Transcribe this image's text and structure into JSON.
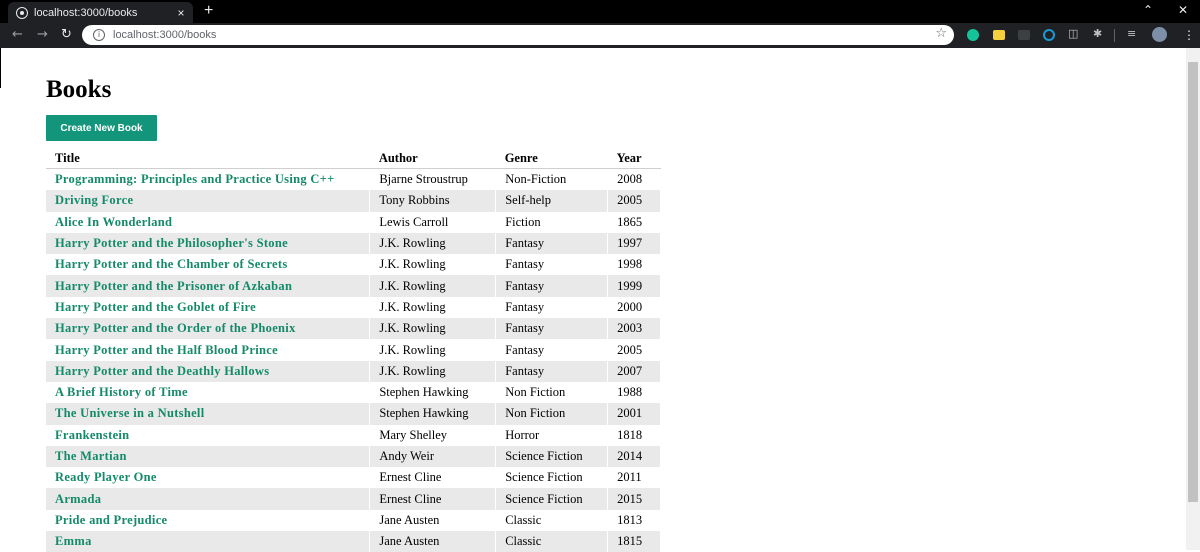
{
  "browser": {
    "tab_title": "localhost:3000/books",
    "tab_close": "×",
    "new_tab": "+",
    "url": "localhost:3000/books",
    "back": "←",
    "forward": "→",
    "reload": "↻",
    "star": "☆",
    "window_min": "⌃",
    "window_close": "✕",
    "menu": "⋮",
    "extensions": [
      "grammarly-icon",
      "notes-icon",
      "tab-icon",
      "record-icon",
      "translate-icon",
      "bug-icon",
      "playlist-icon",
      "profile-avatar"
    ]
  },
  "page": {
    "title": "Books",
    "create_button": "Create New Book"
  },
  "table": {
    "headers": [
      "Title",
      "Author",
      "Genre",
      "Year"
    ],
    "rows": [
      [
        "Programming: Principles and Practice Using C++",
        "Bjarne Stroustrup",
        "Non-Fiction",
        "2008"
      ],
      [
        "Driving Force",
        "Tony Robbins",
        "Self-help",
        "2005"
      ],
      [
        "Alice In Wonderland",
        "Lewis Carroll",
        "Fiction",
        "1865"
      ],
      [
        "Harry Potter and the Philosopher's Stone",
        "J.K. Rowling",
        "Fantasy",
        "1997"
      ],
      [
        "Harry Potter and the Chamber of Secrets",
        "J.K. Rowling",
        "Fantasy",
        "1998"
      ],
      [
        "Harry Potter and the Prisoner of Azkaban",
        "J.K. Rowling",
        "Fantasy",
        "1999"
      ],
      [
        "Harry Potter and the Goblet of Fire",
        "J.K. Rowling",
        "Fantasy",
        "2000"
      ],
      [
        "Harry Potter and the Order of the Phoenix",
        "J.K. Rowling",
        "Fantasy",
        "2003"
      ],
      [
        "Harry Potter and the Half Blood Prince",
        "J.K. Rowling",
        "Fantasy",
        "2005"
      ],
      [
        "Harry Potter and the Deathly Hallows",
        "J.K. Rowling",
        "Fantasy",
        "2007"
      ],
      [
        "A Brief History of Time",
        "Stephen Hawking",
        "Non Fiction",
        "1988"
      ],
      [
        "The Universe in a Nutshell",
        "Stephen Hawking",
        "Non Fiction",
        "2001"
      ],
      [
        "Frankenstein",
        "Mary Shelley",
        "Horror",
        "1818"
      ],
      [
        "The Martian",
        "Andy Weir",
        "Science Fiction",
        "2014"
      ],
      [
        "Ready Player One",
        "Ernest Cline",
        "Science Fiction",
        "2011"
      ],
      [
        "Armada",
        "Ernest Cline",
        "Science Fiction",
        "2015"
      ],
      [
        "Pride and Prejudice",
        "Jane Austen",
        "Classic",
        "1813"
      ],
      [
        "Emma",
        "Jane Austen",
        "Classic",
        "1815"
      ]
    ]
  },
  "colors": {
    "accent": "#12957a",
    "link": "#148a69",
    "row_stripe": "#e9e9e9",
    "chrome_dark": "#202124"
  }
}
